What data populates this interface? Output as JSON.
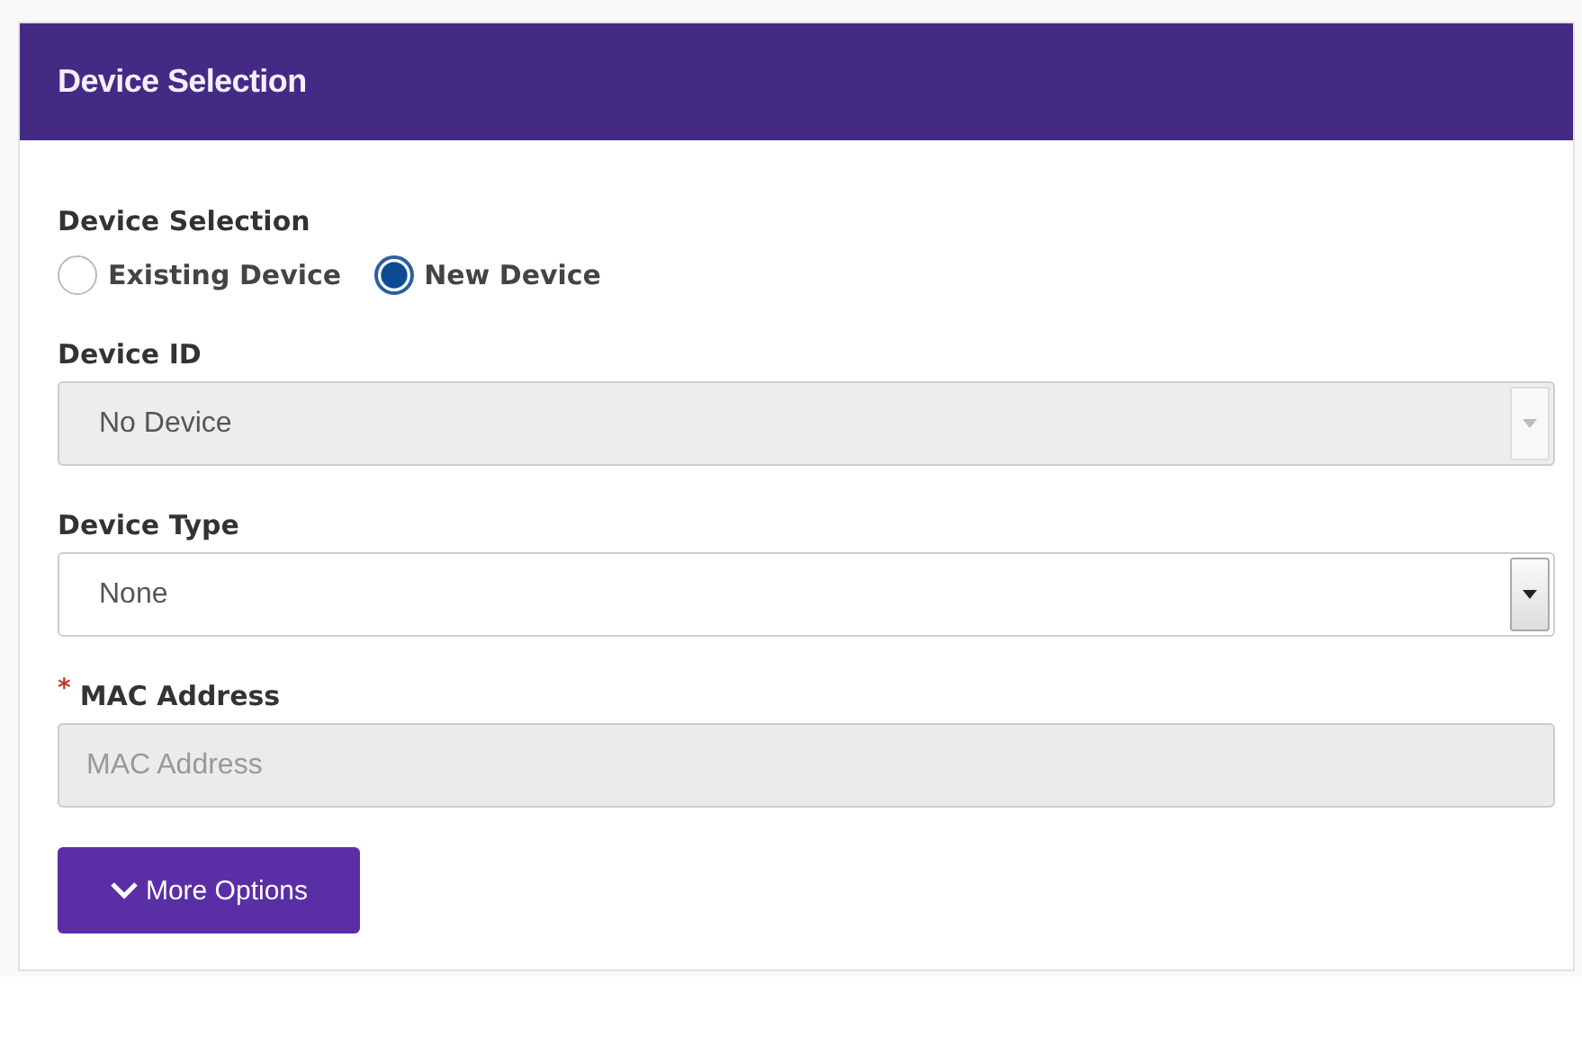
{
  "panel": {
    "title": "Device Selection"
  },
  "device_selection": {
    "label": "Device Selection",
    "options": [
      {
        "label": "Existing Device",
        "selected": false
      },
      {
        "label": "New Device",
        "selected": true
      }
    ]
  },
  "fields": [
    {
      "kind": "select",
      "label": "Device ID",
      "value": "No Device",
      "disabled": true
    },
    {
      "kind": "select",
      "label": "Device Type",
      "value": "None",
      "disabled": false
    },
    {
      "kind": "text",
      "label": "MAC Address",
      "required_mark": "*",
      "placeholder": "MAC Address",
      "disabled": true
    }
  ],
  "more_options_button": {
    "label": "More Options"
  }
}
